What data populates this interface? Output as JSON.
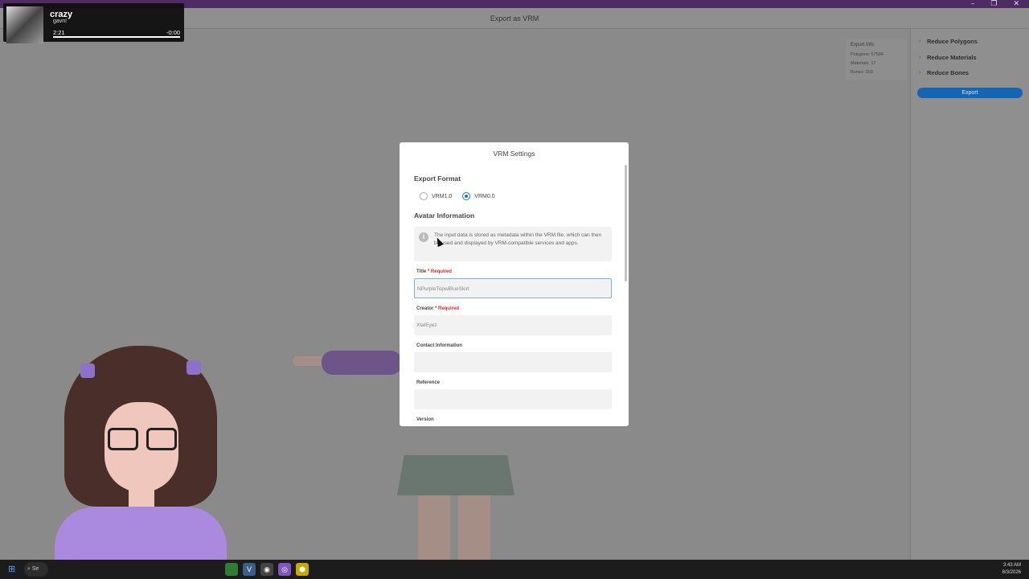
{
  "window": {
    "title": "Export as VRM",
    "controls": [
      "–",
      "❐",
      "✕"
    ]
  },
  "media_overlay": {
    "song": "crazy",
    "artist": "gavn!",
    "elapsed": "2:21",
    "remaining": "-0:00",
    "progress": 1.0
  },
  "export_info": {
    "heading": "Export Info",
    "polygons": "Polygons: 57584",
    "materials": "Materials: 17",
    "bones": "Bones: 203"
  },
  "right_panel": {
    "items": [
      {
        "label": "Reduce Polygons"
      },
      {
        "label": "Reduce Materials"
      },
      {
        "label": "Reduce Bones"
      }
    ],
    "export_label": "Export"
  },
  "dialog": {
    "title": "VRM Settings",
    "export_format": {
      "heading": "Export Format",
      "options": [
        "VRM1.0",
        "VRM0.0"
      ],
      "selected": "VRM0.0"
    },
    "avatar_info": {
      "heading": "Avatar Information",
      "notice": "The input data is stored as metadata within the VRM file, which can then be used and displayed by VRM-compatible services and apps."
    },
    "fields": {
      "title_label": "Title",
      "title_required": "* Required",
      "title_value": "NPurpleTopwBlueSkirt",
      "creator_label": "Creator",
      "creator_required": "* Required",
      "creator_value": "XtalEyez",
      "contact_label": "Contact Information",
      "contact_value": "",
      "reference_label": "Reference",
      "reference_value": "",
      "version_label": "Version"
    }
  },
  "taskbar": {
    "search_label": "Se",
    "time": "3:43 AM",
    "date": "8/3/2026"
  },
  "colors": {
    "accent": "#1976d2",
    "required": "#d32f2f",
    "export_button": "#1565b5",
    "title_strip": "#4c2c63"
  }
}
